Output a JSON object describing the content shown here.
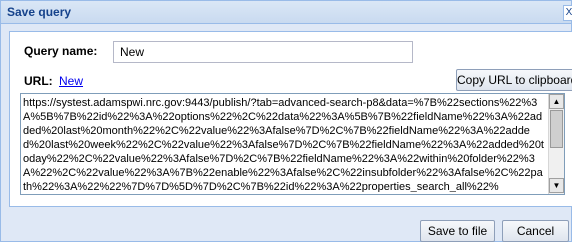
{
  "dialog": {
    "title": "Save query",
    "close_icon": "close-icon",
    "close_glyph": "X"
  },
  "form": {
    "query_name_label": "Query name:",
    "query_name_value": "New",
    "url_label": "URL:",
    "url_link": "New",
    "copy_button": "Copy URL to clipboard",
    "url_value": "https://systest.adamspwi.nrc.gov:9443/publish/?tab=advanced-search-p8&data=%7B%22sections%22%3A%5B%7B%22id%22%3A%22options%22%2C%22data%22%3A%5B%7B%22fieldName%22%3A%22added%20last%20month%22%2C%22value%22%3Afalse%7D%2C%7B%22fieldName%22%3A%22added%20last%20week%22%2C%22value%22%3Afalse%7D%2C%7B%22fieldName%22%3A%22added%20today%22%2C%22value%22%3Afalse%7D%2C%7B%22fieldName%22%3A%22within%20folder%22%3A%22%2C%22value%22%3A%7B%22enable%22%3Afalse%2C%22insubfolder%22%3Afalse%2C%22path%22%3A%22%22%7D%7D%5D%7D%2C%7B%22id%22%3A%22properties_search_all%22%"
  },
  "scrollbar": {
    "up_icon": "scroll-up-icon",
    "down_icon": "scroll-down-icon",
    "up_glyph": "▲",
    "down_glyph": "▼"
  },
  "footer": {
    "save_button": "Save to file",
    "cancel_button": "Cancel"
  },
  "colors": {
    "title_text": "#15428b",
    "panel_background": "#dfe8f6",
    "border": "#99bbe8",
    "link": "#0000ee"
  }
}
